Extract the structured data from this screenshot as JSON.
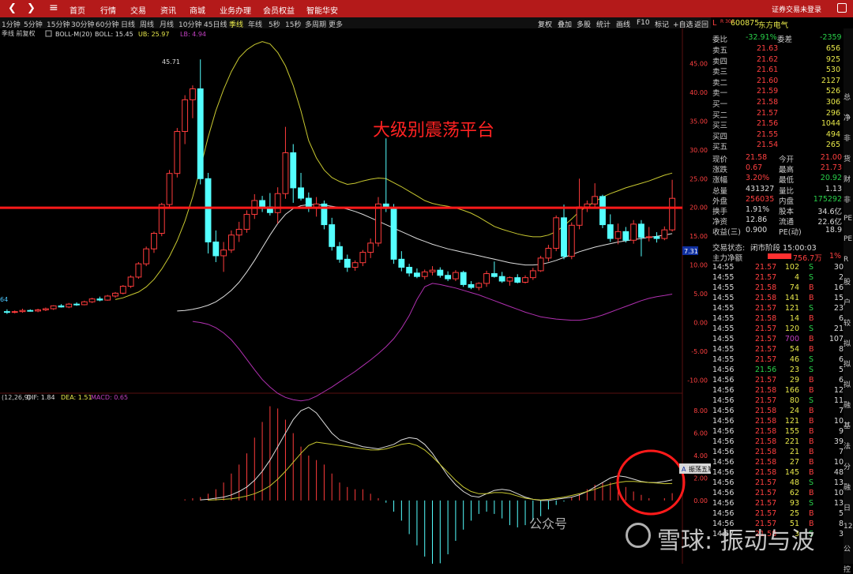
{
  "topbar": {
    "menus": [
      "首页",
      "行情",
      "交易",
      "资讯",
      "商城",
      "业务办理",
      "会员权益",
      "智能华安"
    ],
    "right_text": "证券交易未登录"
  },
  "periods": [
    "1分钟",
    "5分钟",
    "15分钟",
    "30分钟",
    "60分钟",
    "日线",
    "周线",
    "月线",
    "10分钟",
    "45日线",
    "季线",
    "年线",
    "5秒",
    "15秒",
    "多周期",
    "更多"
  ],
  "selected_period": "季线",
  "toolbar": [
    "复权",
    "叠加",
    "多股",
    "统计",
    "画线",
    "F10",
    "标记",
    "+自选",
    "返回"
  ],
  "main_indicator": {
    "prefix": "季线 前复权",
    "boll_label": "BOLL-M(20)",
    "boll": "BOLL: 15.45",
    "ub": "UB: 25.97",
    "lb": "LB: 4.94"
  },
  "macd_indicator": {
    "prefix": "(12,26,9)",
    "dif": "DIF: 1.84",
    "dea": "DEA: 1.51",
    "macd": "MACD: 0.65"
  },
  "annotation": "大级别震荡平台",
  "peak_label": "45.71",
  "low_label": "64",
  "price_tag": "7.31",
  "axis_main": [
    "45.00",
    "40.00",
    "35.00",
    "30.00",
    "25.00",
    "20.00",
    "15.00",
    "10.00",
    "5.00",
    "0.00",
    "-5.00",
    "-10.00"
  ],
  "axis_macd": [
    "8.00",
    "6.00",
    "4.00",
    "2.00",
    "0.00"
  ],
  "popup": {
    "a": "A",
    "label": "振荡五笔",
    "b1": "◢",
    "b2": "◁",
    "b3": "▷"
  },
  "watermark": {
    "small": "公众号",
    "big": "雪球: 振动与波"
  },
  "stock": {
    "code": "600875",
    "name": "东方电气",
    "flag_l": "L",
    "flag_r": "R 300"
  },
  "order_ratio": {
    "label": "委比",
    "value": "-32.91%",
    "label2": "委差",
    "value2": "-2359"
  },
  "asks": [
    {
      "label": "卖五",
      "price": "21.63",
      "vol": "656"
    },
    {
      "label": "卖四",
      "price": "21.62",
      "vol": "925"
    },
    {
      "label": "卖三",
      "price": "21.61",
      "vol": "530"
    },
    {
      "label": "卖二",
      "price": "21.60",
      "vol": "2127"
    },
    {
      "label": "卖一",
      "price": "21.59",
      "vol": "526"
    }
  ],
  "bids": [
    {
      "label": "买一",
      "price": "21.58",
      "vol": "306"
    },
    {
      "label": "买二",
      "price": "21.57",
      "vol": "296"
    },
    {
      "label": "买三",
      "price": "21.56",
      "vol": "1044"
    },
    {
      "label": "买四",
      "price": "21.55",
      "vol": "494"
    },
    {
      "label": "买五",
      "price": "21.54",
      "vol": "265"
    }
  ],
  "quote": [
    {
      "l1": "现价",
      "v1": "21.58",
      "l2": "今开",
      "v2": "21.00"
    },
    {
      "l1": "涨跌",
      "v1": "0.67",
      "l2": "最高",
      "v2": "21.73"
    },
    {
      "l1": "涨幅",
      "v1": "3.20%",
      "l2": "最低",
      "v2": "20.92"
    },
    {
      "l1": "总量",
      "v1": "431327",
      "l2": "量比",
      "v2": "1.13"
    },
    {
      "l1": "外盘",
      "v1": "256035",
      "l2": "内盘",
      "v2": "175292"
    },
    {
      "l1": "换手",
      "v1": "1.91%",
      "l2": "股本",
      "v2": "34.6亿"
    },
    {
      "l1": "净资",
      "v1": "12.86",
      "l2": "流通",
      "v2": "22.6亿"
    },
    {
      "l1": "收益(三)",
      "v1": "0.900",
      "l2": "PE(动)",
      "v2": "18.9"
    }
  ],
  "trade_status": {
    "label": "交易状态:",
    "value": "闭市阶段 15:00:03"
  },
  "net_flow": {
    "label": "主力净额",
    "value": "756.7万",
    "pct": "1%"
  },
  "ticks": [
    [
      "14:55",
      "21.57",
      "102",
      "S",
      "30"
    ],
    [
      "14:55",
      "21.57",
      "4",
      "S",
      "2"
    ],
    [
      "14:55",
      "21.58",
      "74",
      "B",
      "16"
    ],
    [
      "14:55",
      "21.58",
      "141",
      "B",
      "15"
    ],
    [
      "14:55",
      "21.57",
      "121",
      "S",
      "23"
    ],
    [
      "14:55",
      "21.58",
      "14",
      "B",
      "6"
    ],
    [
      "14:55",
      "21.57",
      "120",
      "S",
      "21"
    ],
    [
      "14:55",
      "21.57",
      "700",
      "B",
      "107"
    ],
    [
      "14:55",
      "21.57",
      "54",
      "B",
      "8"
    ],
    [
      "14:55",
      "21.57",
      "46",
      "S",
      "6"
    ],
    [
      "14:56",
      "21.56",
      "23",
      "S",
      "5"
    ],
    [
      "14:56",
      "21.57",
      "29",
      "B",
      "6"
    ],
    [
      "14:56",
      "21.58",
      "166",
      "B",
      "12"
    ],
    [
      "14:56",
      "21.57",
      "80",
      "S",
      "11"
    ],
    [
      "14:56",
      "21.58",
      "24",
      "B",
      "7"
    ],
    [
      "14:56",
      "21.58",
      "121",
      "B",
      "10"
    ],
    [
      "14:56",
      "21.58",
      "155",
      "B",
      "9"
    ],
    [
      "14:56",
      "21.58",
      "221",
      "B",
      "39"
    ],
    [
      "14:56",
      "21.58",
      "21",
      "B",
      "7"
    ],
    [
      "14:56",
      "21.58",
      "27",
      "B",
      "10"
    ],
    [
      "14:56",
      "21.58",
      "145",
      "B",
      "48"
    ],
    [
      "14:56",
      "21.57",
      "48",
      "S",
      "13"
    ],
    [
      "14:56",
      "21.57",
      "62",
      "B",
      "10"
    ],
    [
      "14:56",
      "21.57",
      "93",
      "S",
      "13"
    ],
    [
      "14:56",
      "21.57",
      "25",
      "B",
      "5"
    ],
    [
      "14:56",
      "21.57",
      "51",
      "B",
      "8"
    ],
    [
      "14:57",
      "21.58",
      "3",
      "S",
      "3"
    ]
  ],
  "farright": [
    "总",
    "净",
    "非",
    "货",
    "财",
    "非",
    "PE",
    "PE",
    "R",
    "股",
    "户",
    "较",
    "拟",
    "拟",
    "拟",
    "融",
    "基",
    "法",
    "分",
    "融",
    "日",
    "12",
    "公",
    "控"
  ],
  "chart_data": {
    "type": "candlestick",
    "period": "季线",
    "series": [
      {
        "o": 1.9,
        "h": 2.3,
        "l": 1.5,
        "c": 1.8
      },
      {
        "o": 1.8,
        "h": 2.1,
        "l": 1.6,
        "c": 1.9
      },
      {
        "o": 1.9,
        "h": 2.4,
        "l": 1.7,
        "c": 2.1
      },
      {
        "o": 2.1,
        "h": 2.3,
        "l": 1.9,
        "c": 2.0
      },
      {
        "o": 2.0,
        "h": 2.4,
        "l": 1.8,
        "c": 2.2
      },
      {
        "o": 2.2,
        "h": 2.6,
        "l": 2.0,
        "c": 2.4
      },
      {
        "o": 2.4,
        "h": 3.0,
        "l": 2.2,
        "c": 2.9
      },
      {
        "o": 2.9,
        "h": 3.2,
        "l": 2.6,
        "c": 2.7
      },
      {
        "o": 2.7,
        "h": 3.4,
        "l": 2.5,
        "c": 3.2
      },
      {
        "o": 3.2,
        "h": 3.5,
        "l": 2.9,
        "c": 3.1
      },
      {
        "o": 3.1,
        "h": 3.8,
        "l": 3.0,
        "c": 3.6
      },
      {
        "o": 3.6,
        "h": 4.3,
        "l": 3.4,
        "c": 4.1
      },
      {
        "o": 4.1,
        "h": 4.5,
        "l": 3.7,
        "c": 3.9
      },
      {
        "o": 3.9,
        "h": 4.8,
        "l": 3.8,
        "c": 4.6
      },
      {
        "o": 4.6,
        "h": 5.3,
        "l": 4.3,
        "c": 5.1
      },
      {
        "o": 5.1,
        "h": 6.5,
        "l": 4.9,
        "c": 6.3
      },
      {
        "o": 6.3,
        "h": 8.2,
        "l": 6.0,
        "c": 7.9
      },
      {
        "o": 7.9,
        "h": 10.5,
        "l": 7.6,
        "c": 10.2
      },
      {
        "o": 10.2,
        "h": 13.2,
        "l": 9.8,
        "c": 12.8
      },
      {
        "o": 12.8,
        "h": 15.8,
        "l": 12.1,
        "c": 15.5
      },
      {
        "o": 15.5,
        "h": 20.8,
        "l": 15.0,
        "c": 20.5
      },
      {
        "o": 20.5,
        "h": 26.5,
        "l": 19.8,
        "c": 25.9
      },
      {
        "o": 25.9,
        "h": 33.8,
        "l": 25.2,
        "c": 33.2
      },
      {
        "o": 33.2,
        "h": 39.5,
        "l": 31.0,
        "c": 38.7
      },
      {
        "o": 38.7,
        "h": 41.2,
        "l": 35.5,
        "c": 40.6
      },
      {
        "o": 40.6,
        "h": 45.71,
        "l": 24.0,
        "c": 25.0
      },
      {
        "o": 25.0,
        "h": 26.0,
        "l": 12.0,
        "c": 14.0
      },
      {
        "o": 14.0,
        "h": 16.0,
        "l": 10.5,
        "c": 11.6
      },
      {
        "o": 11.6,
        "h": 14.0,
        "l": 8.8,
        "c": 12.6
      },
      {
        "o": 12.6,
        "h": 16.0,
        "l": 12.1,
        "c": 15.2
      },
      {
        "o": 15.2,
        "h": 17.5,
        "l": 14.0,
        "c": 16.2
      },
      {
        "o": 16.2,
        "h": 19.5,
        "l": 15.6,
        "c": 18.8
      },
      {
        "o": 18.8,
        "h": 22.3,
        "l": 18.0,
        "c": 21.2
      },
      {
        "o": 21.2,
        "h": 22.0,
        "l": 19.2,
        "c": 20.1
      },
      {
        "o": 20.1,
        "h": 22.5,
        "l": 18.6,
        "c": 19.1
      },
      {
        "o": 19.1,
        "h": 23.5,
        "l": 17.2,
        "c": 22.4
      },
      {
        "o": 22.4,
        "h": 34.0,
        "l": 21.5,
        "c": 29.5
      },
      {
        "o": 29.5,
        "h": 31.0,
        "l": 20.8,
        "c": 23.4
      },
      {
        "o": 23.4,
        "h": 26.0,
        "l": 21.2,
        "c": 21.6
      },
      {
        "o": 21.6,
        "h": 22.6,
        "l": 19.2,
        "c": 20.0
      },
      {
        "o": 20.0,
        "h": 21.8,
        "l": 18.4,
        "c": 20.6
      },
      {
        "o": 20.6,
        "h": 21.2,
        "l": 16.2,
        "c": 17.0
      },
      {
        "o": 17.0,
        "h": 18.2,
        "l": 12.5,
        "c": 13.2
      },
      {
        "o": 13.2,
        "h": 14.0,
        "l": 10.4,
        "c": 11.0
      },
      {
        "o": 11.0,
        "h": 11.8,
        "l": 8.8,
        "c": 9.6
      },
      {
        "o": 9.6,
        "h": 10.8,
        "l": 9.0,
        "c": 10.4
      },
      {
        "o": 10.4,
        "h": 12.6,
        "l": 9.8,
        "c": 12.2
      },
      {
        "o": 12.2,
        "h": 14.6,
        "l": 11.2,
        "c": 13.8
      },
      {
        "o": 13.8,
        "h": 21.8,
        "l": 13.2,
        "c": 20.6
      },
      {
        "o": 20.6,
        "h": 32.0,
        "l": 19.2,
        "c": 19.9
      },
      {
        "o": 19.9,
        "h": 20.6,
        "l": 10.2,
        "c": 11.0
      },
      {
        "o": 11.0,
        "h": 12.4,
        "l": 8.9,
        "c": 9.6
      },
      {
        "o": 9.6,
        "h": 10.2,
        "l": 8.0,
        "c": 8.6
      },
      {
        "o": 8.6,
        "h": 9.4,
        "l": 7.7,
        "c": 8.0
      },
      {
        "o": 8.0,
        "h": 9.2,
        "l": 7.5,
        "c": 8.8
      },
      {
        "o": 8.8,
        "h": 9.8,
        "l": 8.2,
        "c": 9.1
      },
      {
        "o": 9.1,
        "h": 9.6,
        "l": 7.8,
        "c": 8.2
      },
      {
        "o": 8.2,
        "h": 8.9,
        "l": 7.2,
        "c": 7.6
      },
      {
        "o": 7.6,
        "h": 9.1,
        "l": 7.2,
        "c": 8.7
      },
      {
        "o": 8.7,
        "h": 9.0,
        "l": 6.2,
        "c": 6.6
      },
      {
        "o": 6.6,
        "h": 7.2,
        "l": 5.8,
        "c": 6.1
      },
      {
        "o": 6.1,
        "h": 7.0,
        "l": 5.6,
        "c": 6.8
      },
      {
        "o": 6.8,
        "h": 9.0,
        "l": 6.2,
        "c": 8.5
      },
      {
        "o": 8.5,
        "h": 10.6,
        "l": 7.8,
        "c": 8.0
      },
      {
        "o": 8.0,
        "h": 8.8,
        "l": 6.9,
        "c": 7.2
      },
      {
        "o": 7.2,
        "h": 8.0,
        "l": 6.4,
        "c": 7.8
      },
      {
        "o": 7.8,
        "h": 8.4,
        "l": 6.8,
        "c": 7.0
      },
      {
        "o": 7.0,
        "h": 8.2,
        "l": 6.8,
        "c": 7.8
      },
      {
        "o": 7.8,
        "h": 9.5,
        "l": 7.4,
        "c": 9.0
      },
      {
        "o": 9.0,
        "h": 11.6,
        "l": 8.8,
        "c": 11.2
      },
      {
        "o": 11.2,
        "h": 13.5,
        "l": 10.6,
        "c": 12.9
      },
      {
        "o": 12.9,
        "h": 18.6,
        "l": 12.4,
        "c": 18.2
      },
      {
        "o": 18.2,
        "h": 20.5,
        "l": 11.0,
        "c": 11.5
      },
      {
        "o": 11.5,
        "h": 17.4,
        "l": 11.0,
        "c": 16.9
      },
      {
        "o": 16.9,
        "h": 25.0,
        "l": 16.2,
        "c": 20.1
      },
      {
        "o": 20.1,
        "h": 21.2,
        "l": 19.2,
        "c": 20.6
      },
      {
        "o": 20.6,
        "h": 24.2,
        "l": 19.8,
        "c": 21.9
      },
      {
        "o": 21.9,
        "h": 22.2,
        "l": 16.4,
        "c": 17.0
      },
      {
        "o": 17.0,
        "h": 18.8,
        "l": 14.0,
        "c": 14.6
      },
      {
        "o": 14.6,
        "h": 17.2,
        "l": 13.6,
        "c": 15.8
      },
      {
        "o": 15.8,
        "h": 16.6,
        "l": 13.9,
        "c": 14.3
      },
      {
        "o": 14.3,
        "h": 17.8,
        "l": 13.7,
        "c": 17.1
      },
      {
        "o": 17.1,
        "h": 17.8,
        "l": 11.5,
        "c": 14.8
      },
      {
        "o": 14.8,
        "h": 16.6,
        "l": 14.1,
        "c": 14.9
      },
      {
        "o": 14.9,
        "h": 15.7,
        "l": 13.9,
        "c": 14.6
      },
      {
        "o": 14.6,
        "h": 16.7,
        "l": 14.3,
        "c": 16.1
      },
      {
        "o": 16.1,
        "h": 24.8,
        "l": 15.8,
        "c": 21.58
      }
    ],
    "boll_ub": [
      4,
      4.3,
      4.8,
      5.3,
      6.2,
      7.5,
      9.3,
      11.5,
      14.2,
      17.6,
      21.8,
      26.8,
      32.2,
      36.8,
      40.5,
      43.6,
      46.0,
      47.4,
      48.3,
      48.8,
      48.4,
      46.9,
      44.6,
      41.2,
      36.8,
      31.6,
      28.6,
      26.5,
      25.2,
      24.5,
      24.0,
      24.2,
      24.6,
      24.9,
      25.1,
      25.0,
      24.3,
      23.6,
      22.8,
      22.0,
      21.2,
      20.7,
      20.4,
      20.2,
      19.9,
      19.5,
      19.0,
      18.3,
      17.5,
      16.7,
      16.2,
      15.8,
      15.4,
      15.1,
      14.9,
      14.9,
      15.2,
      15.8,
      16.8,
      18.0,
      19.3,
      20.2,
      21.0,
      21.8,
      22.4,
      22.9,
      23.4,
      23.8,
      24.2,
      24.6,
      25.1,
      25.6,
      25.97
    ],
    "boll_mid": [
      2,
      2.1,
      2.3,
      2.6,
      3.0,
      3.6,
      4.5,
      5.6,
      7.0,
      8.8,
      10.8,
      13.0,
      15.2,
      17.2,
      18.8,
      19.8,
      20.3,
      20.5,
      20.5,
      20.4,
      20.2,
      20.0,
      19.7,
      19.3,
      18.8,
      18.2,
      17.6,
      17.0,
      16.4,
      15.8,
      15.2,
      14.6,
      14.1,
      13.6,
      13.2,
      12.8,
      12.5,
      12.2,
      11.9,
      11.6,
      11.3,
      11.0,
      10.7,
      10.4,
      10.2,
      10.0,
      10.0,
      10.1,
      10.4,
      10.8,
      11.3,
      11.8,
      12.3,
      12.7,
      13.1,
      13.4,
      13.7,
      14.0,
      14.2,
      14.4,
      14.6,
      14.8,
      15.0,
      15.2,
      15.45
    ],
    "boll_lb": [
      0.2,
      0.0,
      -0.3,
      -0.9,
      -1.8,
      -3.0,
      -4.6,
      -6.4,
      -8.2,
      -9.9,
      -11.2,
      -12.3,
      -13.0,
      -13.4,
      -13.6,
      -13.4,
      -12.8,
      -12.0,
      -11.2,
      -10.3,
      -9.4,
      -8.5,
      -7.5,
      -6.5,
      -5.4,
      -4.2,
      -2.8,
      -1.0,
      1.2,
      4.0,
      6.2,
      6.8,
      6.6,
      6.3,
      6.0,
      5.6,
      5.2,
      4.8,
      4.3,
      3.8,
      3.3,
      2.8,
      2.3,
      1.8,
      1.4,
      1.0,
      0.8,
      0.6,
      0.5,
      0.4,
      0.4,
      0.6,
      0.9,
      1.3,
      1.8,
      2.3,
      2.8,
      3.3,
      3.8,
      4.2,
      4.5,
      4.7,
      4.94
    ],
    "macd_dif": [
      0.05,
      0.1,
      0.2,
      0.3,
      0.5,
      0.8,
      1.2,
      1.8,
      2.6,
      3.6,
      4.8,
      6.0,
      7.2,
      8.0,
      8.3,
      7.8,
      6.9,
      6.0,
      5.4,
      5.2,
      5.0,
      4.8,
      4.7,
      4.6,
      4.8,
      5.0,
      5.4,
      5.6,
      5.5,
      5.0,
      4.2,
      3.2,
      2.2,
      1.4,
      0.8,
      0.4,
      0.3,
      0.6,
      0.9,
      1.0,
      0.9,
      0.6,
      0.3,
      0.1,
      0.0,
      0.0,
      0.1,
      0.2,
      0.3,
      0.5,
      0.8,
      1.2,
      1.6,
      2.0,
      2.2,
      2.1,
      1.9,
      1.7,
      1.6,
      1.6,
      1.7,
      1.84
    ],
    "macd_dea": [
      0.03,
      0.06,
      0.1,
      0.15,
      0.25,
      0.4,
      0.6,
      0.9,
      1.3,
      1.9,
      2.6,
      3.4,
      4.2,
      4.9,
      5.2,
      5.1,
      5.0,
      4.9,
      4.8,
      4.7,
      4.6,
      4.5,
      4.5,
      4.6,
      4.8,
      5.0,
      5.1,
      4.9,
      4.5,
      3.9,
      3.2,
      2.5,
      1.8,
      1.2,
      0.8,
      0.6,
      0.6,
      0.7,
      0.7,
      0.6,
      0.4,
      0.2,
      0.1,
      0.05,
      0.1,
      0.2,
      0.3,
      0.45,
      0.6,
      0.8,
      1.0,
      1.25,
      1.45,
      1.6,
      1.7,
      1.7,
      1.65,
      1.6,
      1.55,
      1.5,
      1.51
    ],
    "macd_hist": [
      0.1,
      0.2,
      0.3,
      0.6,
      1.0,
      1.6,
      2.4,
      3.2,
      4.2,
      5.6,
      7.0,
      8.4,
      8.2,
      7.2,
      6.0,
      4.8,
      4.0,
      3.6,
      3.2,
      2.4,
      1.6,
      1.2,
      1.0,
      1.0,
      0.6,
      0.2,
      -0.2,
      -1.0,
      -1.8,
      -3.0,
      -4.0,
      -5.0,
      -5.8,
      -5.6,
      -4.8,
      -3.6,
      -2.6,
      -1.8,
      -1.2,
      -1.0,
      -1.2,
      -1.6,
      -2.2,
      -2.4,
      -2.2,
      -1.8,
      -1.4,
      -0.8,
      -0.4,
      -0.1,
      0.3,
      0.6,
      1.0,
      1.4,
      1.6,
      1.6,
      1.4,
      1.2,
      0.8,
      0.5,
      0.2,
      0.0,
      0.2,
      0.65
    ],
    "annotations": [
      "45.71",
      "大级别震荡平台"
    ],
    "ylim": [
      -12,
      50
    ],
    "macd_ylim": [
      -5.5,
      9
    ],
    "hline": 19.95
  }
}
